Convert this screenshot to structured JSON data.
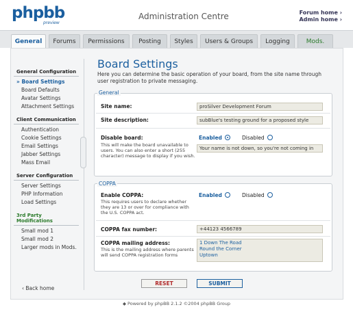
{
  "header": {
    "logo_main": "phpbb",
    "logo_sub": "preview",
    "title": "Administration Centre",
    "links": [
      "Forum home ›",
      "Admin home ›"
    ]
  },
  "tabs": [
    {
      "label": "General",
      "active": true
    },
    {
      "label": "Forums"
    },
    {
      "label": "Permissions"
    },
    {
      "label": "Posting"
    },
    {
      "label": "Styles"
    },
    {
      "label": "Users & Groups"
    },
    {
      "label": "Logging"
    },
    {
      "label": "Mods."
    }
  ],
  "sidebar": {
    "groups": [
      {
        "title": "General Configuration",
        "items": [
          "Board Settings",
          "Board Defaults",
          "Avatar Settings",
          "Attachment Settings"
        ],
        "active": "Board Settings"
      },
      {
        "title": "Client Communication",
        "items": [
          "Authentication",
          "Cookie Settings",
          "Email Settings",
          "Jabber Settings",
          "Mass Email"
        ]
      },
      {
        "title": "Server Configuration",
        "items": [
          "Server Settings",
          "PHP Information",
          "Load Settings"
        ]
      },
      {
        "title": "3rd Party Modifications",
        "items": [
          "Small mod 1",
          "Small mod 2",
          "Larger mods in Mods."
        ]
      }
    ],
    "back_home": "‹ Back home"
  },
  "main": {
    "title": "Board Settings",
    "description": "Here you can determine the basic operation of your board, from the site name through user registration to private messaging."
  },
  "general": {
    "legend": "General",
    "site_name_label": "Site name:",
    "site_name_value": "proSilver Development Forum",
    "site_desc_label": "Site description:",
    "site_desc_value": "subBlue's testing ground for a proposed style",
    "disable_label": "Disable board:",
    "disable_help": "This will make the board unavailable to users. You can also enter a short (255 character) message to display if you wish.",
    "disable_enabled": "Enabled",
    "disable_disabled": "Disabled",
    "disable_message": "Your name is not down, so you're not coming in"
  },
  "coppa": {
    "legend": "COPPA",
    "enable_label": "Enable COPPA:",
    "enable_help": "This requires users to declare whether they are 13 or over for compliance with the U.S. COPPA act.",
    "enabled": "Enabled",
    "disabled": "Disabled",
    "fax_label": "COPPA fax number:",
    "fax_value": "+44123 4566789",
    "mail_label": "COPPA mailing address:",
    "mail_help": "This is the mailing address where parents will send COPPA registration forms",
    "mail_lines": [
      "1 Down The Road",
      "Round the Corner",
      "Uptown"
    ]
  },
  "buttons": {
    "reset": "RESET",
    "submit": "SUBMIT"
  },
  "footer": "Powered by phpBB 2.1.2 ©2004 phpBB Group"
}
